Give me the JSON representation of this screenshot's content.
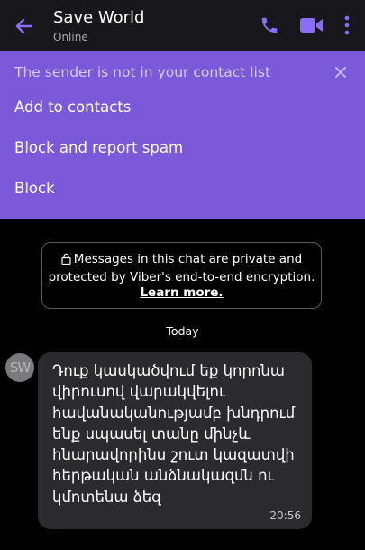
{
  "header": {
    "title": "Save World",
    "status": "Online"
  },
  "colors": {
    "accent": "#7b59d9",
    "header_bg": "#18181c",
    "bubble_bg": "#2a2a2f",
    "icon_purple": "#8c6bff"
  },
  "banner": {
    "text": "The sender is not in your contact list",
    "actions": [
      {
        "label": "Add to contacts"
      },
      {
        "label": "Block and report spam"
      },
      {
        "label": "Block"
      }
    ]
  },
  "encryption_notice": {
    "line1": "Messages in this chat are private and",
    "line2": "protected by Viber's end-to-end encryption.",
    "link": "Learn more."
  },
  "date_divider": "Today",
  "messages": [
    {
      "avatar_initials": "SW",
      "text": "Դուք կասկածվում եք կորոնա վիրուսով վարակվելու հավանականությամբ խնդրում ենք սպասել տանը մինչև հնարավորինս շուտ կազատվի հերթական անձնակազմն ու կմոտենա ձեզ",
      "time": "20:56"
    }
  ],
  "icons": [
    "back-arrow-icon",
    "phone-icon",
    "video-camera-icon",
    "more-vertical-icon",
    "close-icon",
    "lock-icon"
  ]
}
